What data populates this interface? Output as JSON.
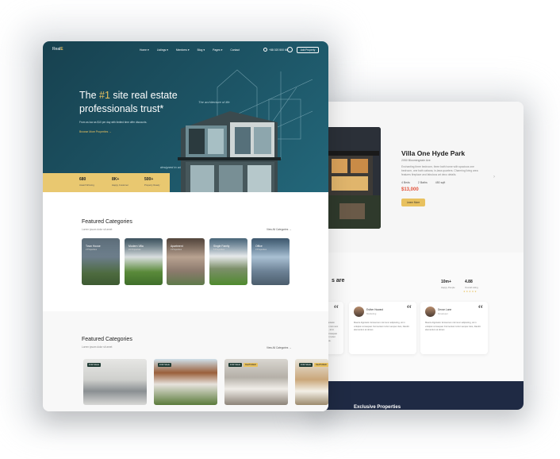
{
  "colors": {
    "hero": "#1d5566",
    "accent": "#e8c15f",
    "price": "#e2523a",
    "footer": "#1f2a44"
  },
  "front": {
    "nav": {
      "logo_left": "Real",
      "logo_right": "E",
      "menu": [
        "Home ▾",
        "Listings ▾",
        "Members ▾",
        "Blog ▾",
        "Pages ▾",
        "Contact"
      ],
      "phone": "+88 020 500 66",
      "add_property": "Add Property"
    },
    "hero": {
      "title_pre": "The ",
      "title_hl": "#1",
      "title_post": " site real estate professionals trust*",
      "subtitle": "From as low as $10 per day with limited time offer discounts.",
      "link": "Browse More Properties  →",
      "note1": "The architecture of life",
      "note2": "designed to win"
    },
    "stats": [
      {
        "value": "680",
        "label": "Award Winning"
      },
      {
        "value": "8K+",
        "label": "Happy Customer"
      },
      {
        "value": "500+",
        "label": "Property Ready"
      }
    ],
    "featured1": {
      "title": "Featured Categories",
      "subtitle": "Lorem ipsum dolor sit amet",
      "link": "View All Categories  →",
      "items": [
        {
          "label": "Town House",
          "count": "2 Properties"
        },
        {
          "label": "Modern Villa",
          "count": "10 Properties"
        },
        {
          "label": "Apartment",
          "count": "3 Properties"
        },
        {
          "label": "Single Family",
          "count": "5 Properties"
        },
        {
          "label": "Office",
          "count": "3 Properties"
        }
      ]
    },
    "featured2": {
      "title": "Featured Categories",
      "subtitle": "Lorem ipsum dolor sit amet",
      "link": "View All Categories  →",
      "badges": [
        [
          "FOR SALE"
        ],
        [
          "FOR SALE"
        ],
        [
          "FOR SALE",
          "FEATURED"
        ],
        [
          "FOR SALE",
          "FEATURED"
        ]
      ]
    }
  },
  "back": {
    "title": "Villa One Hyde Park",
    "address": "2050 Bloomingdale Ave",
    "description": "Enchanting three bedroom, three bath home with spacious one bedroom, one bath cabana, in-laws quarters. Charming living area features fireplace and fabulous art deco details.",
    "specs": [
      "4 Beds",
      "2 Baths",
      "450 sqft"
    ],
    "price": "$13,000",
    "button": "Learn More",
    "section_heading": "s are",
    "stats": [
      {
        "value": "10m+",
        "label": "Happy People"
      },
      {
        "value": "4.88",
        "label": "Overall rating"
      }
    ],
    "stars": "★ ★ ★ ★ ★",
    "testimonials": [
      {
        "name": "Esther Howard",
        "role": "Marketing",
        "text": "Mauris dignissim fermentum nisl nunc adipiscing, sit in volutpat consequat. Fermentum tortor semper duis, blandit elementum at donec."
      },
      {
        "name": "Devon Lane",
        "role": "Developer",
        "text": "Mauris dignissim fermentum nisl nunc adipiscing, sit in volutpat consequat. Fermentum tortor semper duis, blandit elementum at donec."
      }
    ],
    "partial_text": "Mauris dignissim fermentum nisl nunc adipiscing, sit in volutpat consequat. Fermentum tortor semper duis.",
    "footer_heading": "Exclusive Properties"
  }
}
